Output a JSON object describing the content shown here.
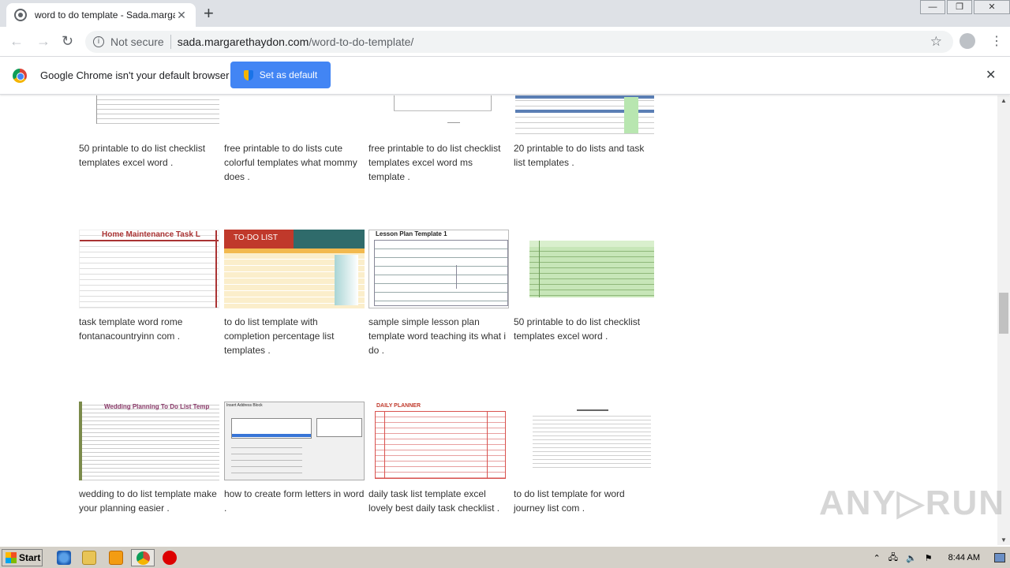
{
  "browser": {
    "tab_title": "word to do template - Sada.margare",
    "tab_close": "✕",
    "new_tab": "+",
    "window_controls": [
      "—",
      "❐",
      "✕"
    ],
    "nav": {
      "back": "←",
      "forward": "→",
      "reload": "↻"
    },
    "address": {
      "security": "Not secure",
      "host": "sada.margarethaydon.com",
      "path": "/word-to-do-template/"
    },
    "bookmark_star": "☆",
    "menu": "⋮"
  },
  "infobar": {
    "message": "Google Chrome isn't your default browser",
    "button": "Set as default",
    "close": "✕"
  },
  "gallery": {
    "rows": [
      [
        {
          "caption": "50 printable to do list checklist templates excel word .",
          "thumb": "lines"
        },
        {
          "caption": "free printable to do lists cute colorful templates what mommy does .",
          "thumb": "blank"
        },
        {
          "caption": "free printable to do list checklist templates excel word ms template .",
          "thumb": "form"
        },
        {
          "caption": "20 printable to do lists and task list templates .",
          "thumb": "sheet-blue"
        }
      ],
      [
        {
          "caption": "task template word rome fontanacountryinn com .",
          "thumb": "home-maint",
          "heading": "Home Maintenance Task L"
        },
        {
          "caption": "to do list template with completion percentage list templates .",
          "thumb": "todo",
          "heading": "TO-DO LIST"
        },
        {
          "caption": "sample simple lesson plan template word teaching its what i do .",
          "thumb": "lesson",
          "heading": "Lesson Plan Template 1"
        },
        {
          "caption": "50 printable to do list checklist templates excel word .",
          "thumb": "green-grid"
        }
      ],
      [
        {
          "caption": "wedding to do list template make your planning easier .",
          "thumb": "wedding",
          "heading": "Wedding Planning To Do List Temp"
        },
        {
          "caption": "how to create form letters in word .",
          "thumb": "dialog",
          "heading": "Insert Address Block"
        },
        {
          "caption": "daily task list template excel lovely best daily task checklist .",
          "thumb": "planner",
          "heading": "DAILY PLANNER"
        },
        {
          "caption": "to do list template for word journey list com .",
          "thumb": "doc"
        }
      ]
    ]
  },
  "watermark": "ANY▷RUN",
  "taskbar": {
    "start": "Start",
    "clock": "8:44 AM"
  }
}
